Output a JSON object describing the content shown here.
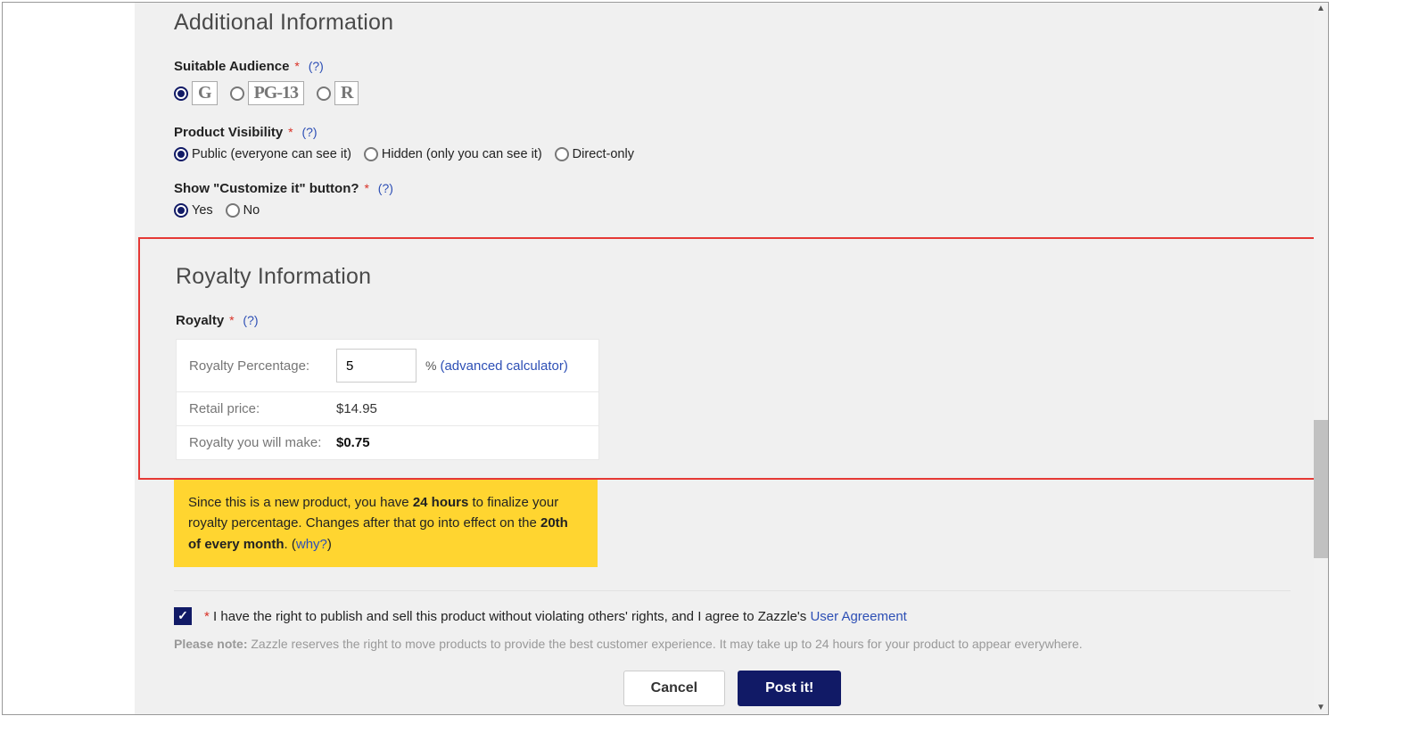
{
  "additional": {
    "title": "Additional Information",
    "suitable_audience": {
      "label": "Suitable Audience",
      "help": "(?)",
      "options": [
        "G",
        "PG-13",
        "R"
      ],
      "selected": "G"
    },
    "visibility": {
      "label": "Product Visibility",
      "help": "(?)",
      "options": {
        "public": "Public (everyone can see it)",
        "hidden": "Hidden (only you can see it)",
        "direct": "Direct-only"
      },
      "selected": "public"
    },
    "customize": {
      "label": "Show \"Customize it\" button?",
      "help": "(?)",
      "yes": "Yes",
      "no": "No",
      "selected": "yes"
    }
  },
  "royalty": {
    "title": "Royalty Information",
    "label": "Royalty",
    "help": "(?)",
    "percentage_label": "Royalty Percentage:",
    "percentage_value": "5",
    "percent_sign": "%",
    "calc_link": "(advanced calculator)",
    "retail_label": "Retail price:",
    "retail_value": "$14.95",
    "make_label": "Royalty you will make:",
    "make_value": "$0.75"
  },
  "notice": {
    "part1": "Since this is a new product, you have ",
    "hours": "24 hours",
    "part2": " to finalize your royalty percentage. Changes after that go into effect on the ",
    "date": "20th of every month",
    "part3": ". (",
    "why": "why?",
    "part4": ")"
  },
  "agree": {
    "required": "*",
    "text_pre": " I have the right to publish and sell this product without violating others' rights, and I agree to Zazzle's ",
    "link": "User Agreement"
  },
  "note": {
    "label": "Please note:",
    "text": " Zazzle reserves the right to move products to provide the best customer experience. It may take up to 24 hours for your product to appear everywhere."
  },
  "buttons": {
    "cancel": "Cancel",
    "post": "Post it!"
  }
}
